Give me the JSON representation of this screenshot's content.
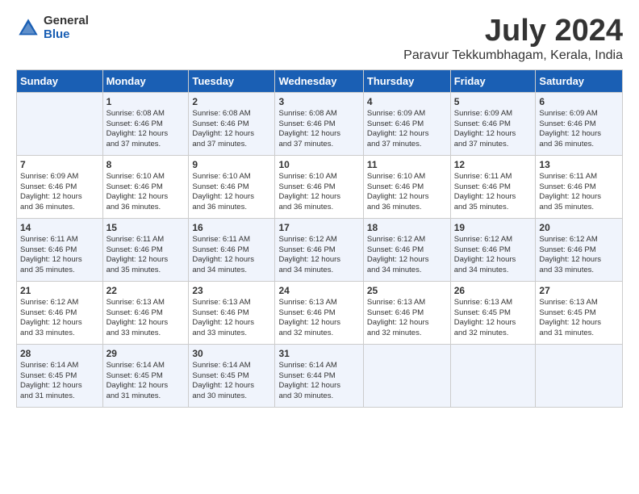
{
  "logo": {
    "general": "General",
    "blue": "Blue"
  },
  "title": "July 2024",
  "subtitle": "Paravur Tekkumbhagam, Kerala, India",
  "weekdays": [
    "Sunday",
    "Monday",
    "Tuesday",
    "Wednesday",
    "Thursday",
    "Friday",
    "Saturday"
  ],
  "weeks": [
    [
      {
        "day": "",
        "info": ""
      },
      {
        "day": "1",
        "info": "Sunrise: 6:08 AM\nSunset: 6:46 PM\nDaylight: 12 hours\nand 37 minutes."
      },
      {
        "day": "2",
        "info": "Sunrise: 6:08 AM\nSunset: 6:46 PM\nDaylight: 12 hours\nand 37 minutes."
      },
      {
        "day": "3",
        "info": "Sunrise: 6:08 AM\nSunset: 6:46 PM\nDaylight: 12 hours\nand 37 minutes."
      },
      {
        "day": "4",
        "info": "Sunrise: 6:09 AM\nSunset: 6:46 PM\nDaylight: 12 hours\nand 37 minutes."
      },
      {
        "day": "5",
        "info": "Sunrise: 6:09 AM\nSunset: 6:46 PM\nDaylight: 12 hours\nand 37 minutes."
      },
      {
        "day": "6",
        "info": "Sunrise: 6:09 AM\nSunset: 6:46 PM\nDaylight: 12 hours\nand 36 minutes."
      }
    ],
    [
      {
        "day": "7",
        "info": "Sunrise: 6:09 AM\nSunset: 6:46 PM\nDaylight: 12 hours\nand 36 minutes."
      },
      {
        "day": "8",
        "info": "Sunrise: 6:10 AM\nSunset: 6:46 PM\nDaylight: 12 hours\nand 36 minutes."
      },
      {
        "day": "9",
        "info": "Sunrise: 6:10 AM\nSunset: 6:46 PM\nDaylight: 12 hours\nand 36 minutes."
      },
      {
        "day": "10",
        "info": "Sunrise: 6:10 AM\nSunset: 6:46 PM\nDaylight: 12 hours\nand 36 minutes."
      },
      {
        "day": "11",
        "info": "Sunrise: 6:10 AM\nSunset: 6:46 PM\nDaylight: 12 hours\nand 36 minutes."
      },
      {
        "day": "12",
        "info": "Sunrise: 6:11 AM\nSunset: 6:46 PM\nDaylight: 12 hours\nand 35 minutes."
      },
      {
        "day": "13",
        "info": "Sunrise: 6:11 AM\nSunset: 6:46 PM\nDaylight: 12 hours\nand 35 minutes."
      }
    ],
    [
      {
        "day": "14",
        "info": "Sunrise: 6:11 AM\nSunset: 6:46 PM\nDaylight: 12 hours\nand 35 minutes."
      },
      {
        "day": "15",
        "info": "Sunrise: 6:11 AM\nSunset: 6:46 PM\nDaylight: 12 hours\nand 35 minutes."
      },
      {
        "day": "16",
        "info": "Sunrise: 6:11 AM\nSunset: 6:46 PM\nDaylight: 12 hours\nand 34 minutes."
      },
      {
        "day": "17",
        "info": "Sunrise: 6:12 AM\nSunset: 6:46 PM\nDaylight: 12 hours\nand 34 minutes."
      },
      {
        "day": "18",
        "info": "Sunrise: 6:12 AM\nSunset: 6:46 PM\nDaylight: 12 hours\nand 34 minutes."
      },
      {
        "day": "19",
        "info": "Sunrise: 6:12 AM\nSunset: 6:46 PM\nDaylight: 12 hours\nand 34 minutes."
      },
      {
        "day": "20",
        "info": "Sunrise: 6:12 AM\nSunset: 6:46 PM\nDaylight: 12 hours\nand 33 minutes."
      }
    ],
    [
      {
        "day": "21",
        "info": "Sunrise: 6:12 AM\nSunset: 6:46 PM\nDaylight: 12 hours\nand 33 minutes."
      },
      {
        "day": "22",
        "info": "Sunrise: 6:13 AM\nSunset: 6:46 PM\nDaylight: 12 hours\nand 33 minutes."
      },
      {
        "day": "23",
        "info": "Sunrise: 6:13 AM\nSunset: 6:46 PM\nDaylight: 12 hours\nand 33 minutes."
      },
      {
        "day": "24",
        "info": "Sunrise: 6:13 AM\nSunset: 6:46 PM\nDaylight: 12 hours\nand 32 minutes."
      },
      {
        "day": "25",
        "info": "Sunrise: 6:13 AM\nSunset: 6:46 PM\nDaylight: 12 hours\nand 32 minutes."
      },
      {
        "day": "26",
        "info": "Sunrise: 6:13 AM\nSunset: 6:45 PM\nDaylight: 12 hours\nand 32 minutes."
      },
      {
        "day": "27",
        "info": "Sunrise: 6:13 AM\nSunset: 6:45 PM\nDaylight: 12 hours\nand 31 minutes."
      }
    ],
    [
      {
        "day": "28",
        "info": "Sunrise: 6:14 AM\nSunset: 6:45 PM\nDaylight: 12 hours\nand 31 minutes."
      },
      {
        "day": "29",
        "info": "Sunrise: 6:14 AM\nSunset: 6:45 PM\nDaylight: 12 hours\nand 31 minutes."
      },
      {
        "day": "30",
        "info": "Sunrise: 6:14 AM\nSunset: 6:45 PM\nDaylight: 12 hours\nand 30 minutes."
      },
      {
        "day": "31",
        "info": "Sunrise: 6:14 AM\nSunset: 6:44 PM\nDaylight: 12 hours\nand 30 minutes."
      },
      {
        "day": "",
        "info": ""
      },
      {
        "day": "",
        "info": ""
      },
      {
        "day": "",
        "info": ""
      }
    ]
  ]
}
